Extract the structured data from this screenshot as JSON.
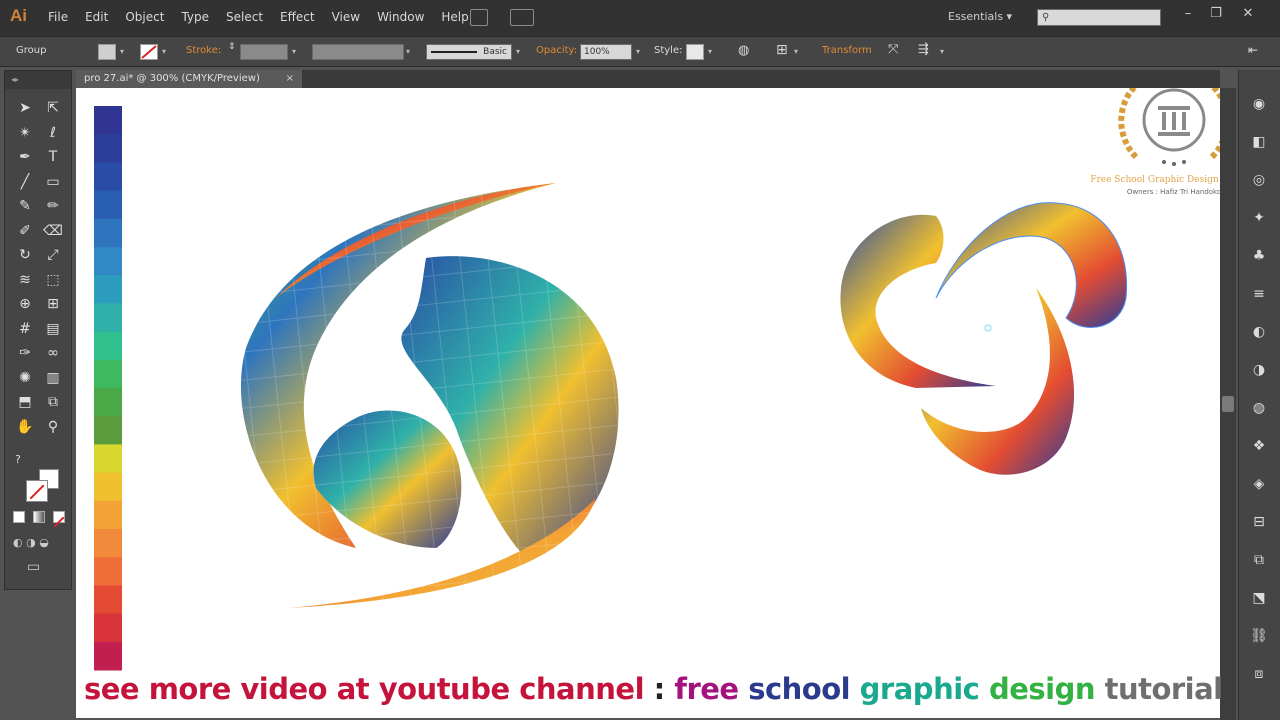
{
  "app": {
    "logo": "Ai",
    "menus": [
      "File",
      "Edit",
      "Object",
      "Type",
      "Select",
      "Effect",
      "View",
      "Window",
      "Help"
    ],
    "workspace": "Essentials",
    "search_placeholder": "",
    "window_controls": [
      "minimize",
      "restore",
      "close"
    ]
  },
  "controlbar": {
    "selection": "Group",
    "stroke_label": "Stroke:",
    "brush_label": "Basic",
    "opacity_label": "Opacity:",
    "opacity_value": "100%",
    "style_label": "Style:",
    "transform_label": "Transform"
  },
  "document": {
    "tab_title": "pro 27.ai* @ 300% (CMYK/Preview)",
    "tab_close": "×"
  },
  "palette": {
    "colors": [
      "#2f3590",
      "#2c3d98",
      "#2a4ca6",
      "#2a5eb3",
      "#2e75be",
      "#3188c4",
      "#2d9dbd",
      "#2fb1a9",
      "#2fc08e",
      "#3fb95f",
      "#4aa847",
      "#5b9c3c",
      "#d9d62e",
      "#f1c02f",
      "#f3a335",
      "#f28a3b",
      "#ee6d39",
      "#e34c32",
      "#d8343a",
      "#c11f4f"
    ]
  },
  "watermark": {
    "line1": "Free School Graphic Design Tutorial",
    "line2": "Owners : Hafiz Tri Handoko",
    "brand_color": "#d89c3c"
  },
  "banner": {
    "part1": "see more video at youtube channel",
    "part2": " : ",
    "part3": "free",
    "part4": " school",
    "part5": " graphic",
    "part6": " design",
    "part7": " tutorial"
  },
  "tools": [
    "selection-tool",
    "direct-selection-tool",
    "magic-wand-tool",
    "lasso-tool",
    "pen-tool",
    "type-tool",
    "line-tool",
    "rectangle-tool",
    "paintbrush-tool",
    "pencil-tool",
    "blob-brush-tool",
    "eraser-tool",
    "rotate-tool",
    "scale-tool",
    "width-tool",
    "free-transform-tool",
    "shape-builder-tool",
    "perspective-grid-tool",
    "mesh-tool",
    "gradient-tool",
    "eyedropper-tool",
    "blend-tool",
    "symbol-sprayer-tool",
    "column-graph-tool",
    "artboard-tool",
    "slice-tool",
    "hand-tool",
    "zoom-tool"
  ],
  "dock": [
    "color-guide",
    "color",
    "swatches",
    "brushes",
    "symbols",
    "stroke",
    "gradient",
    "transparency",
    "appearance",
    "graphic-styles",
    "layers",
    "align",
    "pathfinder",
    "transform",
    "links",
    "artboards"
  ]
}
